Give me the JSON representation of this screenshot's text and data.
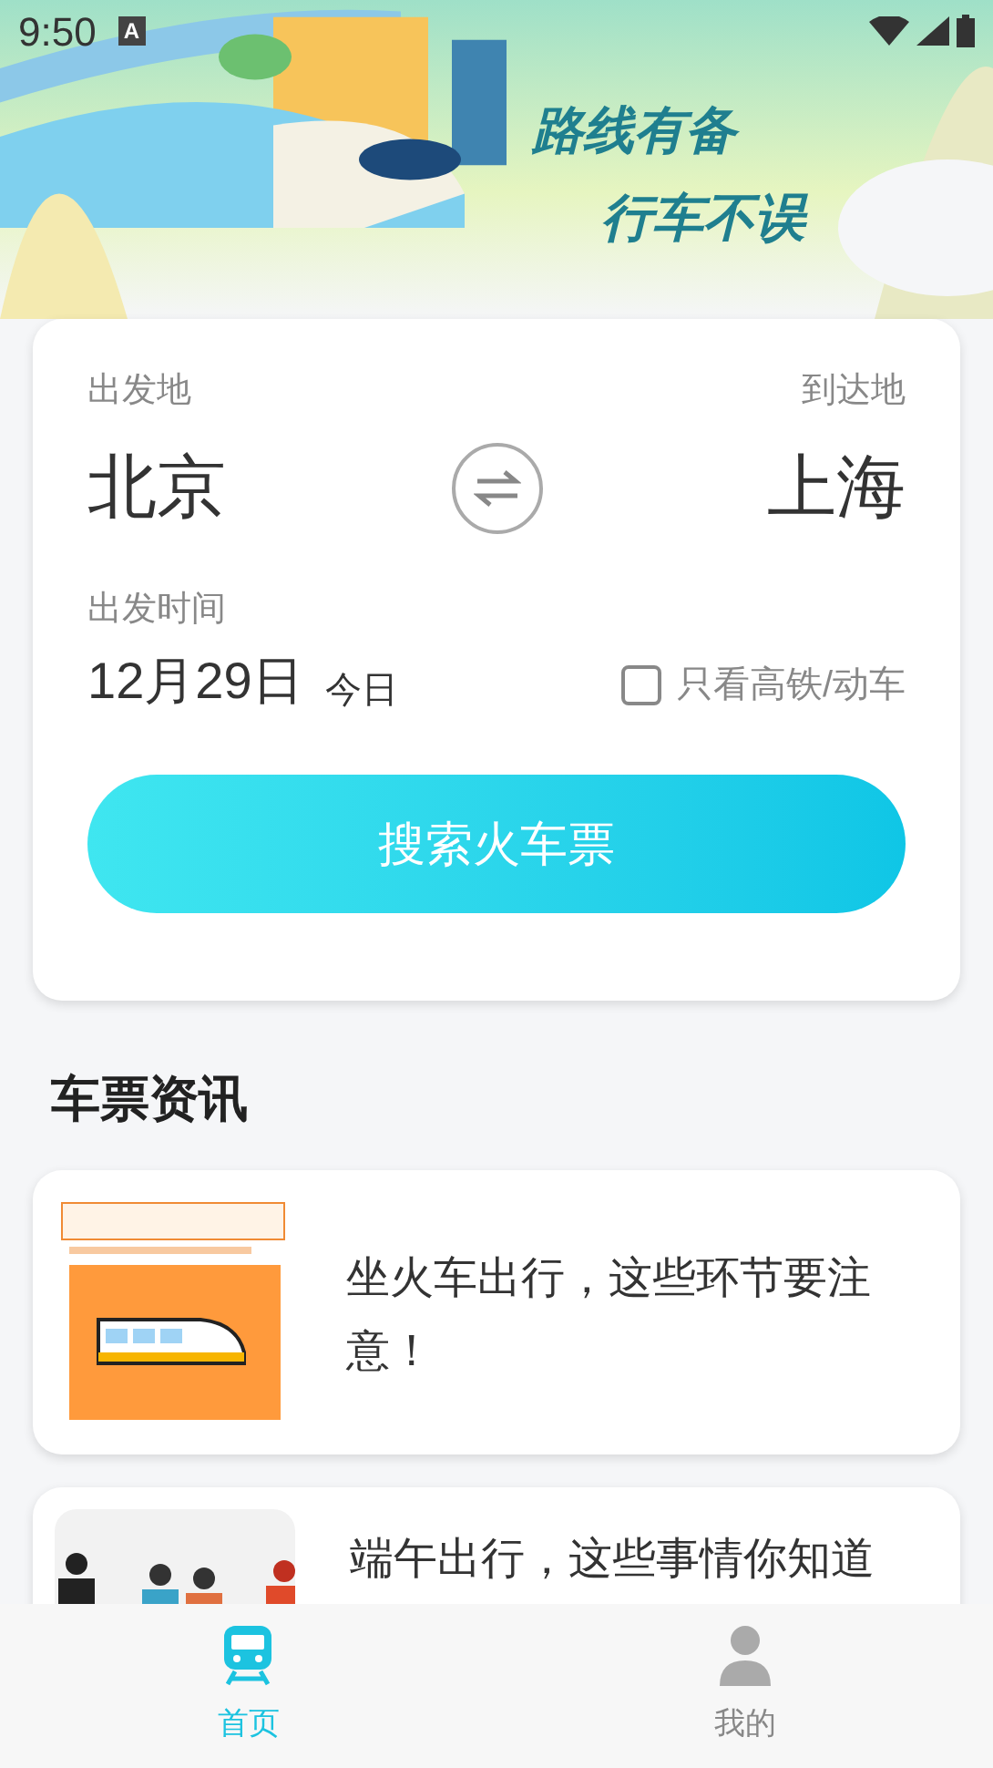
{
  "status_bar": {
    "time": "9:50",
    "notification": "A"
  },
  "banner": {
    "lines": [
      "路线有备",
      "行车不误"
    ]
  },
  "search": {
    "from_label": "出发地",
    "to_label": "到达地",
    "from": "北京",
    "to": "上海",
    "date_label": "出发时间",
    "date": "12月29日",
    "date_note": "今日",
    "high_speed_only": {
      "label": "只看高铁/动车",
      "checked": false
    },
    "button": "搜索火车票"
  },
  "news": {
    "title": "车票资讯",
    "items": [
      {
        "title": "坐火车出行，这些环节要注意！",
        "kind": "train"
      },
      {
        "title": "端午出行，这些事情你知道",
        "kind": "people"
      }
    ]
  },
  "tabs": [
    {
      "label": "首页",
      "selected": true,
      "kind": "train"
    },
    {
      "label": "我的",
      "selected": false,
      "kind": "person"
    }
  ]
}
